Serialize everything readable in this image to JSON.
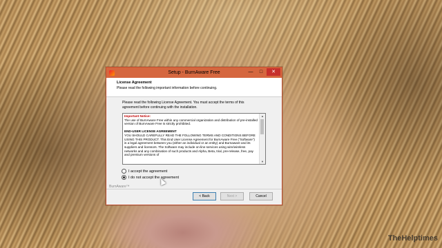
{
  "window": {
    "title": "Setup - BurnAware Free",
    "controls": {
      "minimize": "—",
      "maximize": "□",
      "close": "✕"
    }
  },
  "header": {
    "title": "License Agreement",
    "subtitle": "Please read the following important information before continuing."
  },
  "instructions": "Please read the following License Agreement. You must accept the terms of this agreement before continuing with the installation.",
  "license": {
    "notice_heading": "Important Notice:",
    "notice_text": "The use of BurnAware Free within any commercial organization and distribution of pre-installed version of BurnAware Free is strictly prohibited.",
    "eula_heading": "END-USER LICENSE AGREEMENT",
    "eula_text": "YOU SHOULD CAREFULLY READ THE FOLLOWING TERMS AND CONDITIONS BEFORE USING THIS PRODUCT. This End User License Agreement for BurnAware Free (\"Software\") is a legal agreement between you (either an individual or an entity) and Burnaware and its suppliers and licensors. The Software may include on-line services using wire/wireless networks and any combination of such products and Alpha, Beta, trial, pre-release, free, pay and premium versions of"
  },
  "radios": {
    "accept": "I accept the agreement",
    "decline": "I do not accept the agreement",
    "selected": "decline"
  },
  "brand": "BurnAware™",
  "buttons": {
    "back": "< Back",
    "next": "Next >",
    "cancel": "Cancel"
  },
  "watermark": "TheHelptimes",
  "colors": {
    "titlebar": "#d5673f",
    "close": "#c7302c",
    "notice": "#c00000"
  }
}
